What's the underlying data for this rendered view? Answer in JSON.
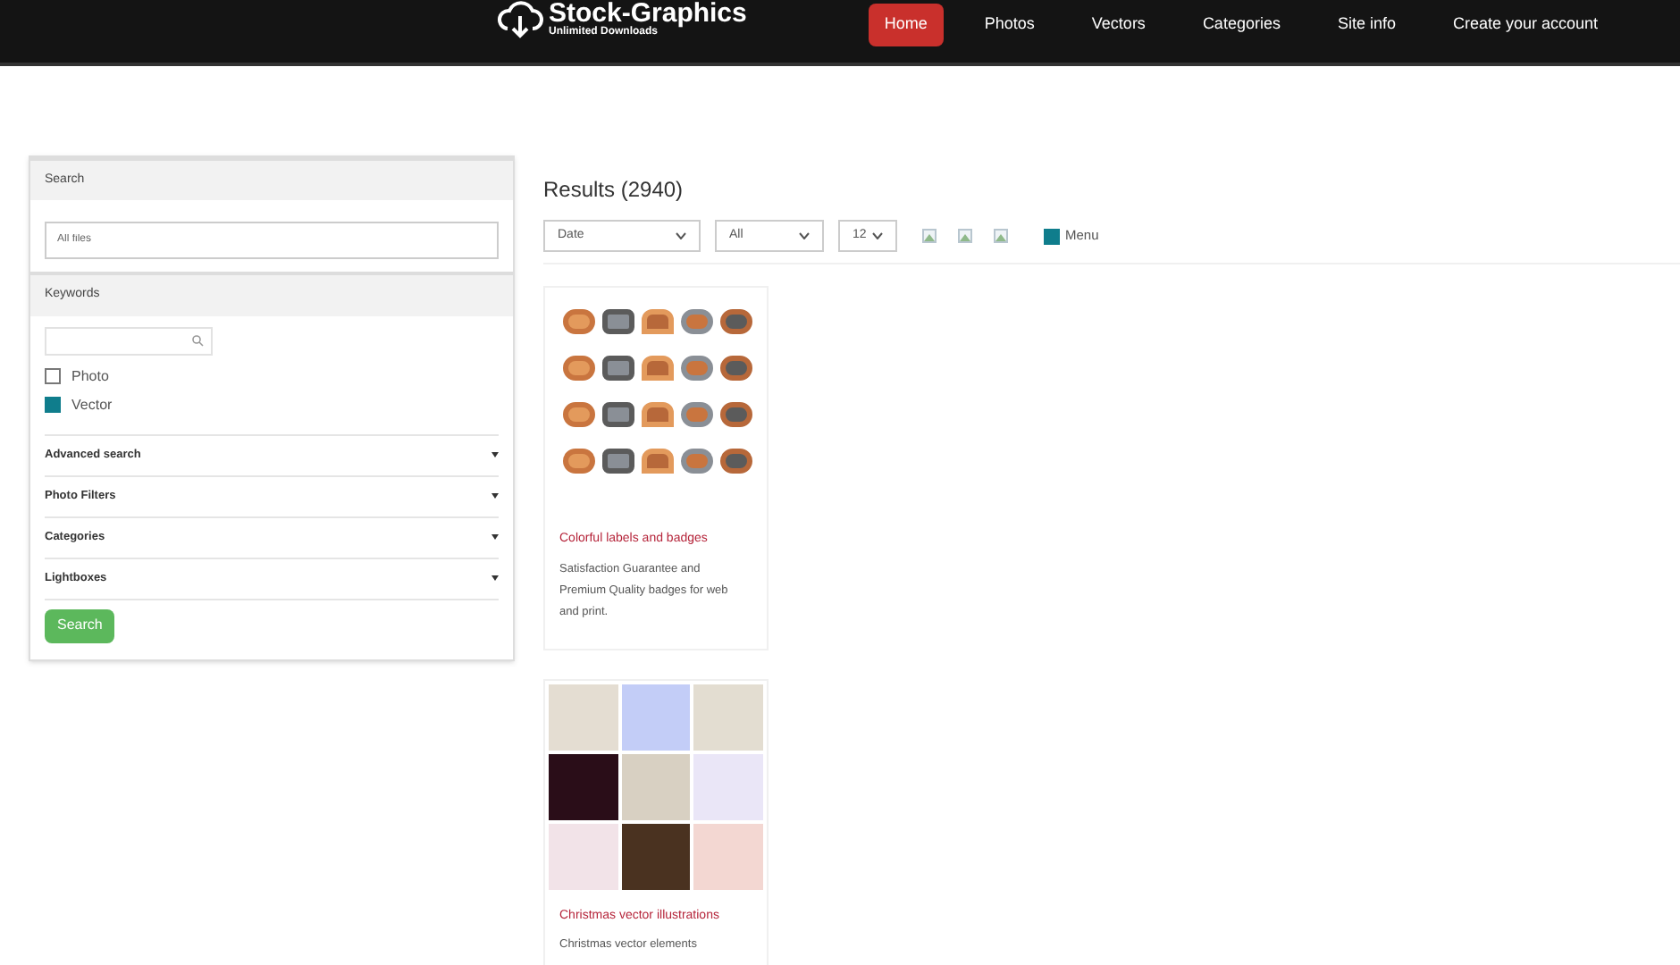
{
  "header": {
    "logo": {
      "title": "Stock-Graphics",
      "subtitle": "Unlimited Downloads"
    },
    "nav": [
      {
        "label": "Home",
        "selected": true
      },
      {
        "label": "Photos",
        "selected": false
      },
      {
        "label": "Vectors",
        "selected": false
      },
      {
        "label": "Categories",
        "selected": false
      },
      {
        "label": "Site info",
        "selected": false
      },
      {
        "label": "Create your account",
        "selected": false
      }
    ]
  },
  "sidebar": {
    "search_title": "Search",
    "search_field": {
      "value": "All files"
    },
    "keywords_title": "Keywords",
    "checkboxes": [
      {
        "label": "Photo",
        "checked": false
      },
      {
        "label": "Vector",
        "checked": true
      }
    ],
    "sections": [
      {
        "label": "Advanced search",
        "expanded": false
      },
      {
        "label": "Photo Filters",
        "expanded": false
      },
      {
        "label": "Categories",
        "expanded": false
      },
      {
        "label": "Lightboxes",
        "expanded": false
      }
    ],
    "button": "Search"
  },
  "results": {
    "title": "Results (2940)",
    "selects": [
      "Date",
      "All",
      "12"
    ],
    "menu_checkbox": {
      "label": "Menu",
      "checked": true
    },
    "cards": [
      {
        "kind": "badges",
        "title": "Colorful labels and badges",
        "description": "Satisfaction Guarantee and Premium Quality badges for web and print."
      },
      {
        "kind": "tiles",
        "title": "Christmas vector illustrations",
        "description": "Christmas vector elements"
      }
    ]
  }
}
